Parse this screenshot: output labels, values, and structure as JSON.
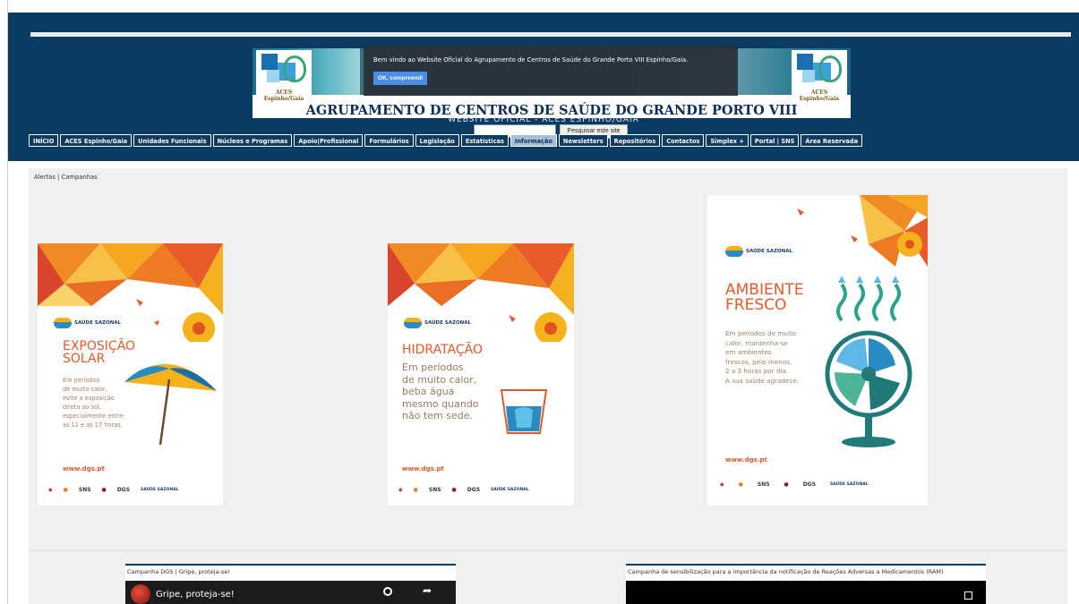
{
  "site": {
    "title": "AGRUPAMENTO DE CENTROS DE SAÚDE DO GRANDE PORTO VIII",
    "subtitle": "WEBSITE OFICIAL - ACES ESPINHO/GAIA",
    "logo_label": "ACES Espinho/Gaia"
  },
  "cookie_banner": {
    "message": "Bem vindo ao Website Oficial do Agrupamento de Centros de Saúde do Grande Porto VIII Espinho/Gaia.",
    "button": "OK, compreendi"
  },
  "search": {
    "placeholder": "",
    "button": "Pesquisar este site"
  },
  "nav": {
    "items": [
      {
        "label": "INÍCIO"
      },
      {
        "label": "ACES Espinho/Gaia"
      },
      {
        "label": "Unidades Funcionais"
      },
      {
        "label": "Núcleos e Programas"
      },
      {
        "label": "Apoio|Profissional"
      },
      {
        "label": "Formulários"
      },
      {
        "label": "Legislação"
      },
      {
        "label": "Estatísticas"
      },
      {
        "label": "Informação"
      },
      {
        "label": "Newsletters"
      },
      {
        "label": "Repositórios"
      },
      {
        "label": "Contactos"
      },
      {
        "label": "Simplex +"
      },
      {
        "label": "Portal | SNS"
      },
      {
        "label": "Área Reservada"
      }
    ],
    "active_index": 8
  },
  "breadcrumb": "Alertas | Campanhas",
  "posters": [
    {
      "brand": "SAÚDE SAZONAL",
      "title": "EXPOSIÇÃO\nSOLAR",
      "body": "Em períodos\nde muito calor,\nevite a exposição\ndireta ao sol,\nespecialmente entre\nas 11 e as 17 horas.",
      "url": "www.dgs.pt",
      "footer": [
        "SNS",
        "DGS",
        "SAÚDE SAZONAL"
      ]
    },
    {
      "brand": "SAÚDE SAZONAL",
      "title": "HIDRATAÇÃO",
      "body": "Em períodos\nde muito calor,\nbeba água\nmesmo quando\nnão tem sede.",
      "url": "www.dgs.pt",
      "footer": [
        "SNS",
        "DGS",
        "SAÚDE SAZONAL"
      ]
    },
    {
      "brand": "SAÚDE SAZONAL",
      "title": "AMBIENTE\nFRESCO",
      "body": "Em períodos de muito\ncalor, mantenha-se\nem ambientes\nfrescos, pelo menos,\n2 a 3 horas por dia.\nA sua saúde agradece.",
      "url": "www.dgs.pt",
      "footer": [
        "SNS",
        "DGS",
        "SAÚDE SAZONAL"
      ]
    }
  ],
  "videos": [
    {
      "caption": "Campanha DGS | Gripe, proteja-se!",
      "title": "Gripe, proteja-se!"
    },
    {
      "caption": "Campanha de sensibilização para a importância da notificação de Reações Adversas a Medicamentos (RAM)",
      "title": ""
    }
  ],
  "colors": {
    "header_bg": "#0b3a63",
    "accent_orange": "#e55a2a",
    "content_bg": "#f0f0f0"
  }
}
